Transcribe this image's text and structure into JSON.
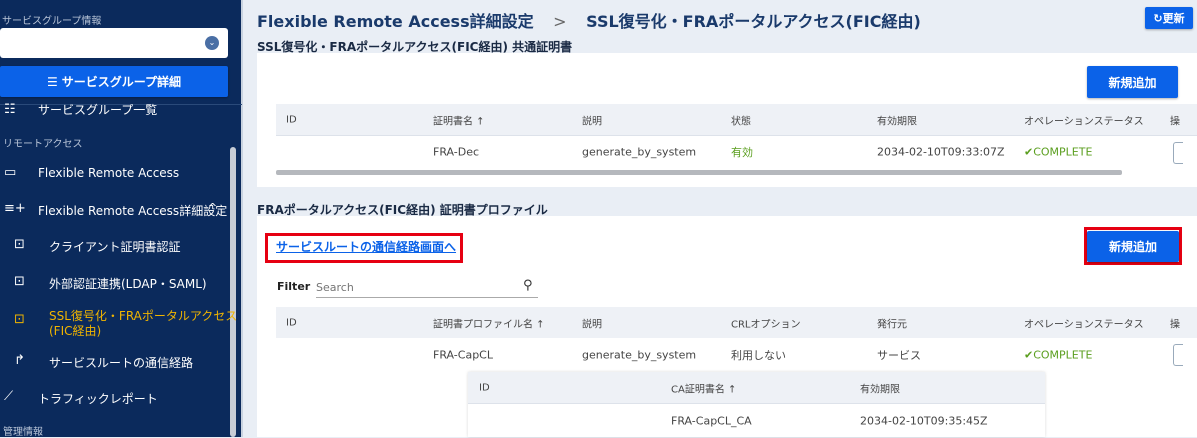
{
  "sidebar": {
    "group_info_label": "サービスグループ情報",
    "select_value": "",
    "group_detail_button": "サービスグループ詳細",
    "group_list": "サービスグループ一覧",
    "remote_access_label": "リモートアクセス",
    "items": [
      {
        "label": "Flexible Remote Access",
        "icon": "laptop-icon"
      },
      {
        "label": "Flexible Remote Access詳細設定",
        "icon": "playlist-add-icon"
      },
      {
        "label": "クライアント証明書認証",
        "icon": "certificate-icon"
      },
      {
        "label": "外部認証連携(LDAP・SAML)",
        "icon": "certificate-icon"
      },
      {
        "label": "SSL復号化・FRAポータルアクセス",
        "label2": "(FIC経由)",
        "icon": "certificate-icon",
        "active": true
      },
      {
        "label": "サービスルートの通信経路",
        "icon": "route-icon"
      },
      {
        "label": "トラフィックレポート",
        "icon": "chart-icon"
      }
    ],
    "management_label": "管理情報",
    "active_color": "#f0b400"
  },
  "header": {
    "breadcrumb_parent": "Flexible Remote Access詳細設定",
    "separator": ">",
    "breadcrumb_current": "SSL復号化・FRAポータルアクセス(FIC経由)",
    "refresh_label": "更新"
  },
  "common_cert": {
    "title": "SSL復号化・FRAポータルアクセス(FIC経由) 共通証明書",
    "add_button": "新規追加",
    "columns": [
      "ID",
      "証明書名 ↑",
      "説明",
      "状態",
      "有効期限",
      "オペレーションステータス",
      "操"
    ],
    "rows": [
      {
        "id": "",
        "name": "FRA-Dec",
        "desc": "generate_by_system",
        "state": "有効",
        "expiry": "2034-02-10T09:33:07Z",
        "op_status": "COMPLETE"
      }
    ]
  },
  "profile": {
    "title": "FRAポータルアクセス(FIC経由) 証明書プロファイル",
    "route_link": "サービスルートの通信経路画面へ",
    "add_button": "新規追加",
    "filter_label": "Filter",
    "search_placeholder": "Search",
    "columns": [
      "ID",
      "証明書プロファイル名 ↑",
      "説明",
      "CRLオプション",
      "発行元",
      "オペレーションステータス",
      "操"
    ],
    "rows": [
      {
        "id": "",
        "name": "FRA-CapCL",
        "desc": "generate_by_system",
        "crl": "利用しない",
        "issuer": "サービス",
        "op_status": "COMPLETE"
      }
    ],
    "ca_columns": [
      "ID",
      "CA証明書名 ↑",
      "有効期限"
    ],
    "ca_rows": [
      {
        "id": "",
        "name": "FRA-CapCL_CA",
        "expiry": "2034-02-10T09:35:45Z"
      }
    ]
  },
  "colors": {
    "primary": "#0b62e8",
    "sidebar": "#0b2a5c",
    "success": "#5a9e1e",
    "highlight": "#e60012"
  }
}
